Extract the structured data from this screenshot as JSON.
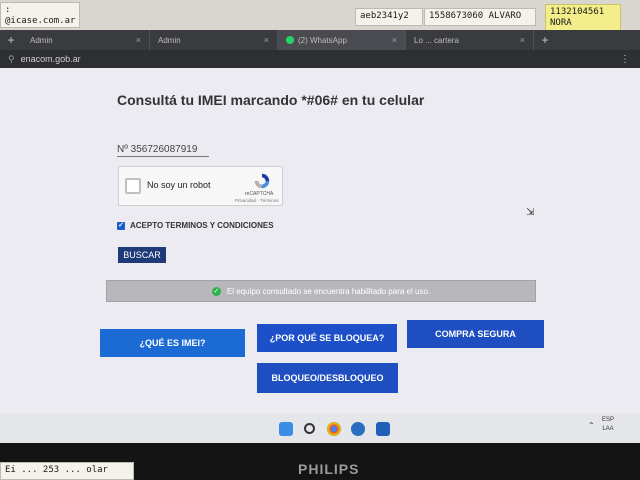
{
  "notes": {
    "n1": ":\n@icase.com.ar",
    "n2": "aeb2341y2",
    "n3": "1558673060 ALVARO",
    "n4": "1132104561\nNORA",
    "n5": "Ei ... 253 ... olar"
  },
  "browser": {
    "tabs": [
      {
        "label": "Admin",
        "active": false
      },
      {
        "label": "Admin",
        "active": false
      },
      {
        "label": "(2) WhatsApp",
        "active": true
      },
      {
        "label": "Lo ... cartera",
        "active": false
      }
    ],
    "new_tab": "+",
    "url": "enacom.gob.ar"
  },
  "page": {
    "title": "Consultá tu IMEI marcando *#06# en tu celular",
    "imei_value": "Nº  356726087919",
    "captcha": {
      "label": "No soy un robot",
      "brand": "reCAPTCHA",
      "links": "Privacidad - Términos"
    },
    "terms_label": "ACEPTO TERMINOS Y CONDICIONES",
    "search_button": "BUSCAR",
    "status_message": "El equipo consultado se encuentra habilitado para el uso.",
    "buttons": {
      "what_is_imei": "¿QUÉ ES IMEI?",
      "why_blocked": "¿POR QUÉ SE BLOQUEA?",
      "safe_purchase": "COMPRA SEGURA",
      "block_unblock": "BLOQUEO/DESBLOQUEO"
    }
  },
  "taskbar": {
    "lang_line1": "ESP",
    "lang_line2": "LAA"
  },
  "monitor_brand": "PHILIPS",
  "colors": {
    "primary_button": "#1e4ec0",
    "search_button": "#1e3a78",
    "status_bar": "#b8b8bc",
    "status_ok": "#2fb14f"
  }
}
